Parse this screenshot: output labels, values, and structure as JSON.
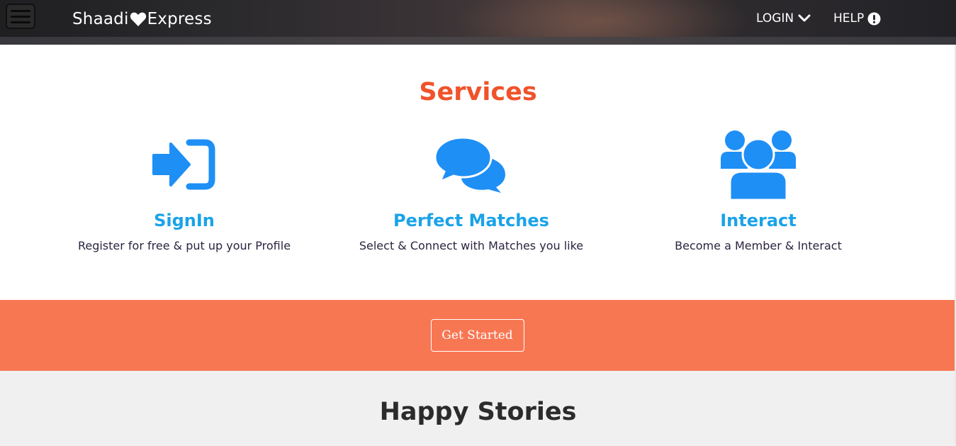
{
  "header": {
    "brand_left": "Shaadi",
    "brand_right": "Express",
    "login_label": "LOGIN",
    "help_label": "HELP"
  },
  "services": {
    "title": "Services",
    "items": [
      {
        "icon": "sign-in-icon",
        "name": "SignIn",
        "desc": "Register for free & put up your Profile"
      },
      {
        "icon": "chat-bubbles-icon",
        "name": "Perfect Matches",
        "desc": "Select & Connect with Matches you like"
      },
      {
        "icon": "users-group-icon",
        "name": "Interact",
        "desc": "Become a Member & Interact"
      }
    ]
  },
  "cta": {
    "button_label": "Get Started"
  },
  "stories": {
    "title": "Happy Stories"
  },
  "colors": {
    "accent_title": "#f0522a",
    "service_name": "#1aa3e8",
    "icon_blue": "#1e8ff5",
    "cta_band": "#f87753",
    "stories_bg": "#f0f0f0"
  }
}
